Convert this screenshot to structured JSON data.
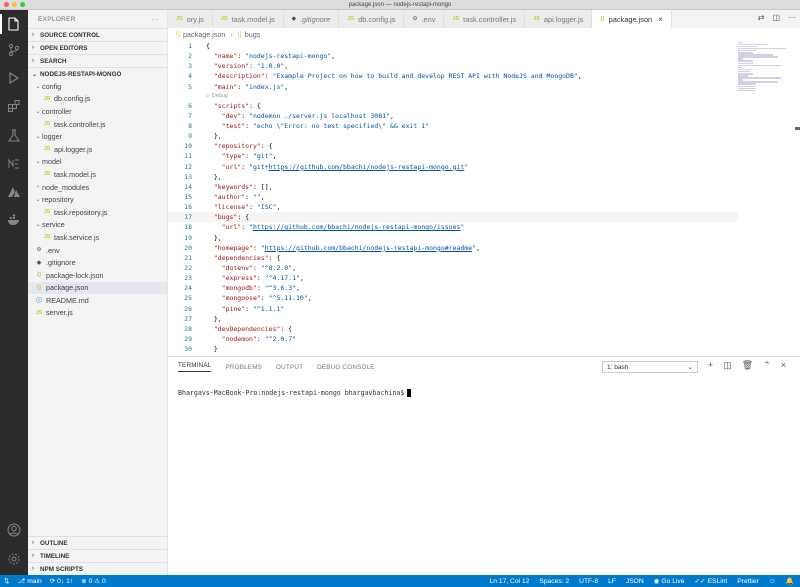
{
  "window": {
    "title": "package.json — nodejs-restapi-mongo"
  },
  "activity_bar": {
    "icons": [
      "explorer-icon",
      "search-icon",
      "source-control-icon",
      "run-debug-icon",
      "extensions-icon",
      "testing-icon",
      "notebook-icon",
      "azure-icon",
      "docker-icon",
      "account-icon",
      "settings-gear-icon"
    ]
  },
  "sidebar": {
    "header": "EXPLORER",
    "more": "···",
    "sections_top": [
      "SOURCE CONTROL",
      "OPEN EDITORS",
      "SEARCH"
    ],
    "project": "NODEJS-RESTAPI-MONGO",
    "tree": [
      {
        "label": "config",
        "type": "folder",
        "indent": 1
      },
      {
        "label": "db.config.js",
        "type": "js",
        "indent": 2
      },
      {
        "label": "controller",
        "type": "folder",
        "indent": 1
      },
      {
        "label": "task.controller.js",
        "type": "js",
        "indent": 2
      },
      {
        "label": "logger",
        "type": "folder",
        "indent": 1
      },
      {
        "label": "api.logger.js",
        "type": "js",
        "indent": 2
      },
      {
        "label": "model",
        "type": "folder",
        "indent": 1
      },
      {
        "label": "task.model.js",
        "type": "js",
        "indent": 2
      },
      {
        "label": "node_modules",
        "type": "folder-closed",
        "indent": 1
      },
      {
        "label": "repository",
        "type": "folder",
        "indent": 1
      },
      {
        "label": "task.repository.js",
        "type": "js",
        "indent": 2
      },
      {
        "label": "service",
        "type": "folder",
        "indent": 1
      },
      {
        "label": "task.service.js",
        "type": "js",
        "indent": 2
      },
      {
        "label": ".env",
        "type": "env",
        "indent": 1
      },
      {
        "label": ".gitignore",
        "type": "git",
        "indent": 1
      },
      {
        "label": "package-lock.json",
        "type": "json",
        "indent": 1
      },
      {
        "label": "package.json",
        "type": "json",
        "indent": 1,
        "selected": true
      },
      {
        "label": "README.md",
        "type": "md",
        "indent": 1
      },
      {
        "label": "server.js",
        "type": "js",
        "indent": 1
      }
    ],
    "sections_bottom": [
      "OUTLINE",
      "TIMELINE",
      "NPM SCRIPTS"
    ]
  },
  "tabs": [
    {
      "label": "ory.js",
      "type": "js"
    },
    {
      "label": "task.model.js",
      "type": "js"
    },
    {
      "label": ".gitignore",
      "type": "git",
      "italic": true
    },
    {
      "label": "db.config.js",
      "type": "js"
    },
    {
      "label": ".env",
      "type": "env"
    },
    {
      "label": "task.controller.js",
      "type": "js"
    },
    {
      "label": "api.logger.js",
      "type": "js"
    },
    {
      "label": "package.json",
      "type": "json",
      "active": true
    }
  ],
  "tab_close": "×",
  "breadcrumb": [
    "package.json",
    "bugs"
  ],
  "code_lens": "▷ Debug",
  "code": [
    {
      "n": "1",
      "t": "{"
    },
    {
      "n": "2",
      "t": "  \"name\": \"nodejs-restapi-mongo\","
    },
    {
      "n": "3",
      "t": "  \"version\": \"1.0.0\","
    },
    {
      "n": "4",
      "t": "  \"description\": \"Example Project on how to build and develop REST API with NodeJS and MongoDB\","
    },
    {
      "n": "5",
      "t": "  \"main\": \"index.js\","
    },
    {
      "n": "6",
      "t": "  \"scripts\": {"
    },
    {
      "n": "7",
      "t": "    \"dev\": \"nodemon ./server.js localhost 3081\","
    },
    {
      "n": "8",
      "t": "    \"test\": \"echo \\\"Error: no test specified\\\" && exit 1\""
    },
    {
      "n": "9",
      "t": "  },"
    },
    {
      "n": "10",
      "t": "  \"repository\": {"
    },
    {
      "n": "11",
      "t": "    \"type\": \"git\","
    },
    {
      "n": "12",
      "t": "    \"url\": \"git+https://github.com/bbachi/nodejs-restapi-mongo.git\""
    },
    {
      "n": "13",
      "t": "  },"
    },
    {
      "n": "14",
      "t": "  \"keywords\": [],"
    },
    {
      "n": "15",
      "t": "  \"author\": \"\","
    },
    {
      "n": "16",
      "t": "  \"license\": \"ISC\","
    },
    {
      "n": "17",
      "t": "  \"bugs\": {"
    },
    {
      "n": "18",
      "t": "    \"url\": \"https://github.com/bbachi/nodejs-restapi-mongo/issues\""
    },
    {
      "n": "19",
      "t": "  },"
    },
    {
      "n": "20",
      "t": "  \"homepage\": \"https://github.com/bbachi/nodejs-restapi-mongo#readme\","
    },
    {
      "n": "21",
      "t": "  \"dependencies\": {"
    },
    {
      "n": "22",
      "t": "    \"dotenv\": \"^8.2.0\","
    },
    {
      "n": "23",
      "t": "    \"express\": \"^4.17.1\","
    },
    {
      "n": "24",
      "t": "    \"mongodb\": \"^3.6.3\","
    },
    {
      "n": "25",
      "t": "    \"mongoose\": \"^5.11.10\","
    },
    {
      "n": "26",
      "t": "    \"pine\": \"^1.1.1\""
    },
    {
      "n": "27",
      "t": "  },"
    },
    {
      "n": "28",
      "t": "  \"devDependencies\": {"
    },
    {
      "n": "29",
      "t": "    \"nodemon\": \"^2.0.7\""
    },
    {
      "n": "30",
      "t": "  }"
    }
  ],
  "panel": {
    "tabs": [
      "TERMINAL",
      "PROBLEMS",
      "OUTPUT",
      "DEBUG CONSOLE"
    ],
    "active_tab": "TERMINAL",
    "terminal_select": "1: bash",
    "prompt": "Bhargavs-MacBook-Pro:nodejs-restapi-mongo bhargavbachina$"
  },
  "statusbar": {
    "branch": "main",
    "sync": "0↓ 1↑",
    "problems": "⊗ 0 ⚠ 0",
    "position": "Ln 17, Col 12",
    "spaces": "Spaces: 2",
    "encoding": "UTF-8",
    "eol": "LF",
    "language": "JSON",
    "golive": "Go Live",
    "eslint": "ESLint",
    "prettier": "Prettier"
  },
  "colors": {
    "status_bar": "#007acc",
    "activity_bar": "#2c2c2c",
    "json_key": "#a31515",
    "json_value": "#0451a5"
  }
}
